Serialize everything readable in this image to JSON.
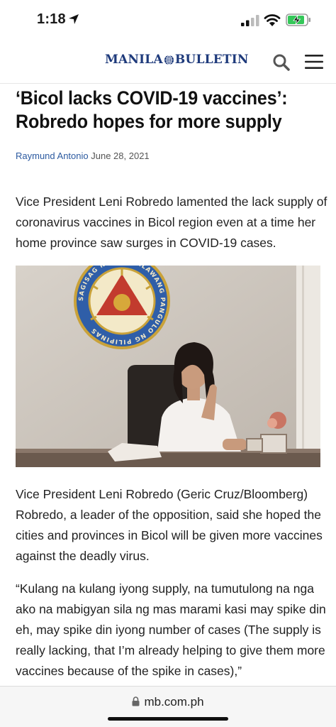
{
  "status_bar": {
    "time": "1:18"
  },
  "header": {
    "logo_left": "MANILA",
    "logo_right": "BULLETIN"
  },
  "article": {
    "headline": "‘Bicol lacks COVID-19 vaccines’: Robredo hopes for more supply",
    "author": "Raymund Antonio",
    "date": "June 28, 2021",
    "paragraphs": [
      "Vice President Leni Robredo lamented the lack supply of coronavirus vaccines in Bicol region even at a time her home province saw surges in COVID-19 cases.",
      "Vice President Leni Robredo (Geric Cruz/Bloomberg) Robredo, a leader of the opposition, said she hoped the cities and provinces in Bicol will be given more vaccines against the deadly virus.",
      "“Kulang na kulang iyong supply, na tumutulong na nga ako na mabigyan sila ng mas marami kasi may spike din eh, may spike din iyong number of cases (The supply is really lacking, that I’m already helping to give them more vaccines because of the spike in cases),”"
    ],
    "seal_text": "SAGISAG NG PANGALAWANG PANGULO NG PILIPINAS"
  },
  "browser": {
    "url": "mb.com.ph"
  }
}
